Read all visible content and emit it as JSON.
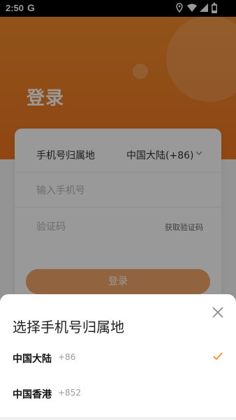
{
  "status_bar": {
    "time": "2:50",
    "g_label": "G"
  },
  "page": {
    "title": "登录",
    "region_label": "手机号归属地",
    "region_value": "中国大陆(+86)",
    "phone_placeholder": "输入手机号",
    "code_placeholder": "验证码",
    "get_code_label": "获取验证码",
    "login_button": "登录"
  },
  "sheet": {
    "title": "选择手机号归属地",
    "options": [
      {
        "name": "中国大陆",
        "code": "+86",
        "selected": true
      },
      {
        "name": "中国香港",
        "code": "+852",
        "selected": false
      }
    ]
  },
  "colors": {
    "accent": "#ee7620",
    "check": "#f28b2c"
  },
  "icons": [
    "location-icon",
    "wifi-icon",
    "signal-icon",
    "battery-icon",
    "chevron-down-icon",
    "close-icon",
    "check-icon"
  ]
}
